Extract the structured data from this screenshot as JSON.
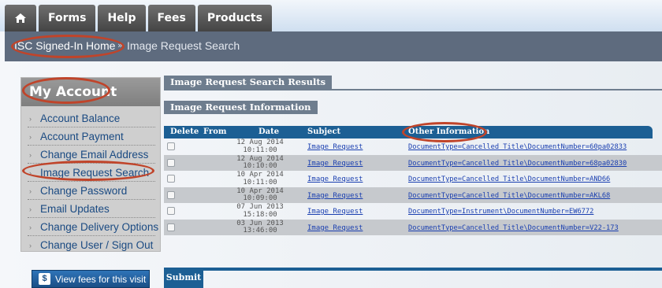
{
  "nav": {
    "home_icon": "home-icon",
    "tabs": [
      "Forms",
      "Help",
      "Fees",
      "Products"
    ]
  },
  "breadcrumb": {
    "home": "ISC Signed-In Home",
    "separator": "»",
    "current": "Image Request Search"
  },
  "sidebar": {
    "title": "My Account",
    "items": [
      "Account Balance",
      "Account Payment",
      "Change Email Address",
      "Image Request Search",
      "Change Password",
      "Email Updates",
      "Change Delivery Options",
      "Change User / Sign Out"
    ],
    "fees_button": "View fees for this visit"
  },
  "main": {
    "results_title": "Image Request Search Results",
    "info_title": "Image Request Information",
    "columns": [
      "Delete",
      "From",
      "Date",
      "Subject",
      "Other Information"
    ],
    "rows": [
      {
        "date": "12 Aug 2014",
        "time": "10:11:00",
        "subject": "Image Request",
        "other": "DocumentType=Cancelled Title\\DocumentNumber=60pa02833"
      },
      {
        "date": "12 Aug 2014",
        "time": "10:10:00",
        "subject": "Image Request",
        "other": "DocumentType=Cancelled Title\\DocumentNumber=68pa02830"
      },
      {
        "date": "10 Apr 2014",
        "time": "10:11:00",
        "subject": "Image Request",
        "other": "DocumentType=Cancelled Title\\DocumentNumber=AND66"
      },
      {
        "date": "10 Apr 2014",
        "time": "10:09:00",
        "subject": "Image Request",
        "other": "DocumentType=Cancelled Title\\DocumentNumber=AKL68"
      },
      {
        "date": "07 Jun 2013",
        "time": "15:18:00",
        "subject": "Image Request",
        "other": "DocumentType=Instrument\\DocumentNumber=EW6772"
      },
      {
        "date": "03 Jun 2013",
        "time": "13:46:00",
        "subject": "Image Request",
        "other": "DocumentType=Cancelled Title\\DocumentNumber=V22-173"
      }
    ],
    "submit_label": "Submit"
  },
  "colors": {
    "nav_tab": "#555555",
    "crumb_bar": "#5e6b7e",
    "table_header": "#1c5f94",
    "link": "#1a3fb0",
    "highlight_oval": "#c0442a"
  }
}
